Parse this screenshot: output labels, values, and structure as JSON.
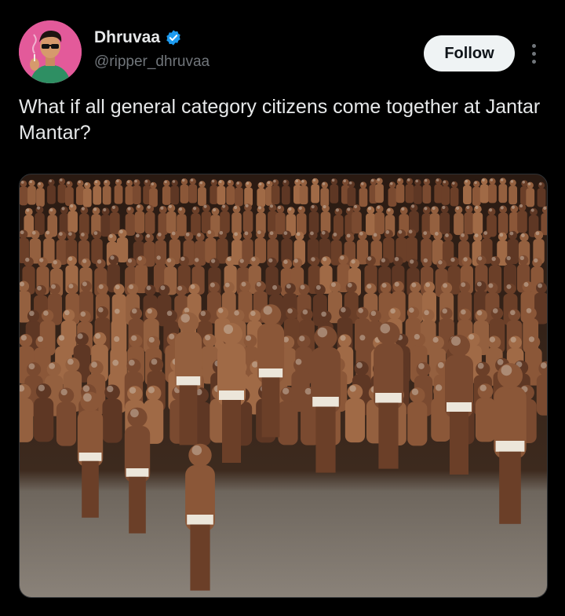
{
  "author": {
    "display_name": "Dhruvaa",
    "handle": "@ripper_dhruvaa",
    "verified_icon": "verified-badge-icon",
    "verified_color": "#1d9bf0"
  },
  "actions": {
    "follow_label": "Follow",
    "more_icon": "more-vertical-icon"
  },
  "tweet": {
    "text": "What if all general category citizens come together at Jantar Mantar?"
  },
  "media": {
    "type": "photo"
  },
  "colors": {
    "background": "#000000",
    "text_primary": "#e7e9ea",
    "text_secondary": "#71767b",
    "follow_bg": "#eff3f4",
    "avatar_bg": "#e04a8f"
  }
}
